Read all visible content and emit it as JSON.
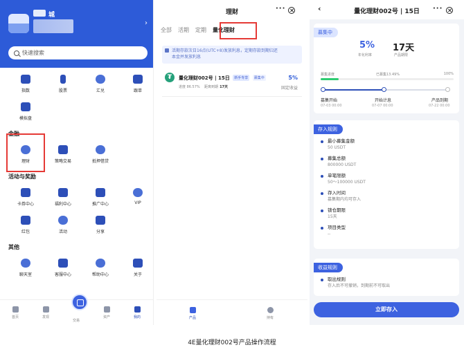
{
  "caption": "4E量化理财002号产品操作流程",
  "screen1": {
    "user": {
      "name_fragment": "城"
    },
    "search_placeholder": "快速搜索",
    "row1": [
      "指数",
      "股票",
      "汇兑",
      "跟单"
    ],
    "row2": [
      "模拟盘"
    ],
    "section_finance": "金融",
    "finance_items": [
      "理财",
      "策略交易",
      "抵押借贷"
    ],
    "section_activity": "活动与奖励",
    "activity_row1": [
      "卡券中心",
      "福利中心",
      "推广中心",
      "VIP"
    ],
    "activity_row2": [
      "红包",
      "活动",
      "分享"
    ],
    "section_other": "其他",
    "other_items": [
      "聊天室",
      "客服中心",
      "帮助中心",
      "关于"
    ],
    "tabbar": [
      "首页",
      "发现",
      "交易",
      "资产",
      "我的"
    ],
    "highlight_color": "#e53935",
    "brand_color": "#2d5bd8"
  },
  "screen2": {
    "title": "理财",
    "tabs": [
      "全部",
      "活期",
      "定期",
      "量化理财"
    ],
    "active_tab": "量化理财",
    "notice": [
      "活期存款次日16点(UTC+8)发放利息，定期存款到期归还",
      "本金并发放利息"
    ],
    "product": {
      "coin_symbol": "₮",
      "name": "量化理财002号 | 15日",
      "badge1": "新手专享",
      "badge2": "募集中",
      "rate": "5%",
      "progress_label": "进度",
      "progress": "86.57%",
      "term_label": "距离到期",
      "term": "17天",
      "type": "固定收益"
    },
    "tabbar": [
      "产品",
      "持有"
    ]
  },
  "screen3": {
    "title": "量化理财002号 | 15日",
    "status_tag": "募集中",
    "rate": "5%",
    "rate_label": "年化利率",
    "term": "17天",
    "term_label": "产品期限",
    "progress_label": "募集进度",
    "progress_text": "已募集13.49%",
    "progress_max": "100%",
    "progress_value": 0.1349,
    "timeline": [
      {
        "label": "募集开始",
        "date": "07-03 00:00"
      },
      {
        "label": "开始计息",
        "date": "07-07 00:00"
      },
      {
        "label": "产品到期",
        "date": "07-22 00:00"
      }
    ],
    "deposit_rules_tag": "存入规则",
    "deposit_rules": [
      {
        "label": "最小募集金额",
        "value": "50 USDT"
      },
      {
        "label": "募集总额",
        "value": "800000 USDT"
      },
      {
        "label": "单笔限额",
        "value": "50～100000 USDT"
      },
      {
        "label": "存入时间",
        "value": "募集期内均可存入"
      },
      {
        "label": "锁仓期限",
        "value": "15天"
      },
      {
        "label": "项目类型",
        "value": "--"
      }
    ],
    "income_rules_tag": "收益规则",
    "income_rules": [
      {
        "label": "取出规则",
        "value": "存入后不可撤销，到期前不可取出"
      }
    ],
    "deposit_button": "立即存入"
  }
}
